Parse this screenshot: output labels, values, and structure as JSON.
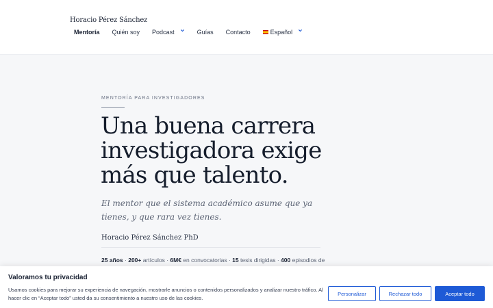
{
  "header": {
    "site_title": "Horacio Pérez Sánchez",
    "nav": {
      "mentoria": "Mentoría",
      "quien_soy": "Quién soy",
      "podcast": "Podcast",
      "guias": "Guías",
      "contacto": "Contacto",
      "idioma": "Español"
    }
  },
  "hero": {
    "eyebrow": "MENTORÍA PARA INVESTIGADORES",
    "headline": "Una buena carrera investigadora exige más que talento.",
    "subhead": "El mentor que el sistema académico asume que ya tienes, y que rara vez tienes.",
    "author": "Horacio Pérez Sánchez PhD",
    "stats": {
      "years_value": "25 años",
      "sep1": " · ",
      "articles_value": "200+",
      "articles_label": " artículos · ",
      "funding_value": "6M€",
      "funding_label": " en convocatorias · ",
      "theses_value": "15",
      "theses_label": " tesis dirigidas · ",
      "episodes_value": "400",
      "episodes_label": " episodios de"
    }
  },
  "cookie_banner": {
    "title": "Valoramos tu privacidad",
    "text": "Usamos cookies para mejorar su experiencia de navegación, mostrarle anuncios o contenidos personalizados y analizar nuestro tráfico. Al hacer clic en “Aceptar todo” usted da su consentimiento a nuestro uso de las cookies.",
    "customize": "Personalizar",
    "reject": "Rechazar todo",
    "accept": "Aceptar todo"
  },
  "colors": {
    "accent": "#1e5ad6",
    "hero_bg": "#f6f7f9",
    "text": "#1a2233"
  }
}
